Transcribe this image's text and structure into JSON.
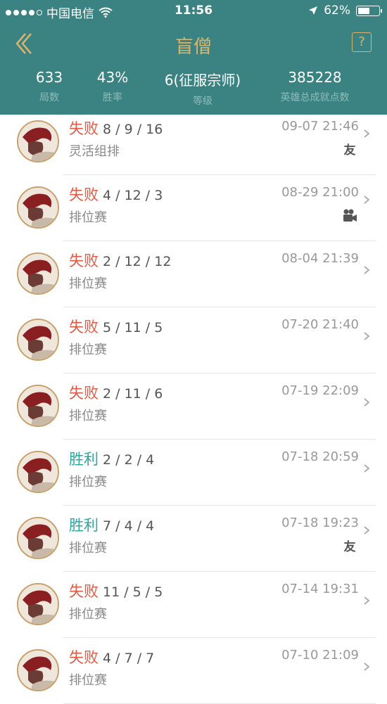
{
  "status_bar": {
    "carrier": "中国电信",
    "time": "11:56",
    "battery": "62%",
    "battery_level": 0.62
  },
  "nav": {
    "title": "盲僧",
    "help": "?"
  },
  "stats": [
    {
      "value": "633",
      "label": "局数"
    },
    {
      "value": "43%",
      "label": "胜率"
    },
    {
      "value": "6(征服宗师)",
      "label": "等级"
    },
    {
      "value": "385228",
      "label": "英雄总成就点数"
    }
  ],
  "matches": [
    {
      "result": "失败",
      "outcome": "lose",
      "kda": "8 / 9 / 16",
      "mode": "灵活组排",
      "time": "09-07 21:46",
      "badge": "friend-icon",
      "badge_text": "友"
    },
    {
      "result": "失败",
      "outcome": "lose",
      "kda": "4 / 12 / 3",
      "mode": "排位赛",
      "time": "08-29 21:00",
      "badge": "video-icon"
    },
    {
      "result": "失败",
      "outcome": "lose",
      "kda": "2 / 12 / 12",
      "mode": "排位赛",
      "time": "08-04 21:39"
    },
    {
      "result": "失败",
      "outcome": "lose",
      "kda": "5 / 11 / 5",
      "mode": "排位赛",
      "time": "07-20 21:40"
    },
    {
      "result": "失败",
      "outcome": "lose",
      "kda": "2 / 11 / 6",
      "mode": "排位赛",
      "time": "07-19 22:09"
    },
    {
      "result": "胜利",
      "outcome": "win",
      "kda": "2 / 2 / 4",
      "mode": "排位赛",
      "time": "07-18 20:59"
    },
    {
      "result": "胜利",
      "outcome": "win",
      "kda": "7 / 4 / 4",
      "mode": "排位赛",
      "time": "07-18 19:23",
      "badge": "friend-icon",
      "badge_text": "友"
    },
    {
      "result": "失败",
      "outcome": "lose",
      "kda": "11 / 5 / 5",
      "mode": "排位赛",
      "time": "07-14 19:31"
    },
    {
      "result": "失败",
      "outcome": "lose",
      "kda": "4 / 7 / 7",
      "mode": "排位赛",
      "time": "07-10 21:09"
    }
  ],
  "colors": {
    "header_bg": "#3b8383",
    "accent_gold": "#d9b46c",
    "lose_red": "#e05a45",
    "win_teal": "#2aa7a1"
  }
}
